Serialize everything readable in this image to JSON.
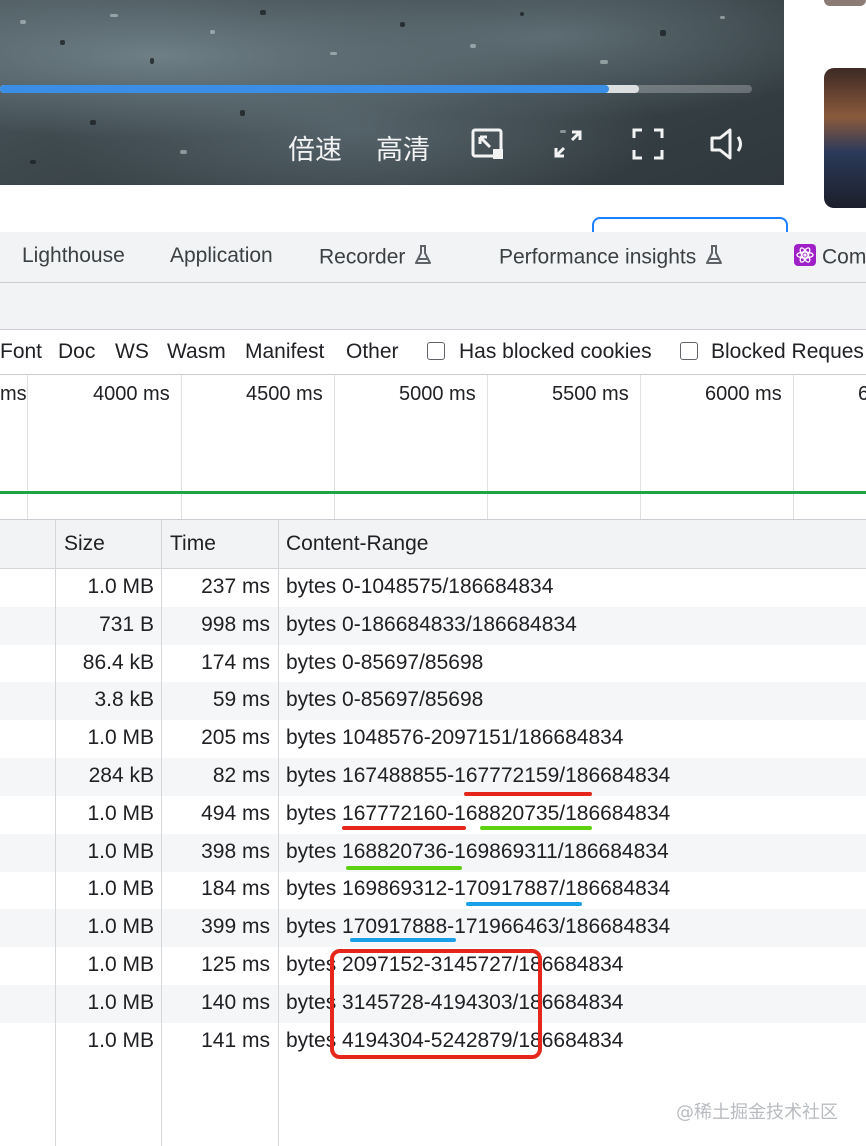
{
  "player": {
    "progress_played_fraction": 0.81,
    "progress_buffered_fraction": 0.85,
    "speed_label": "倍速",
    "quality_label": "高清",
    "accent_color": "#3a8ee6"
  },
  "devtools": {
    "tabs": [
      {
        "label": "Lighthouse"
      },
      {
        "label": "Application"
      },
      {
        "label": "Recorder"
      },
      {
        "label": "Performance insights"
      },
      {
        "label": "Com"
      }
    ],
    "filters": {
      "types": [
        "Font",
        "Doc",
        "WS",
        "Wasm",
        "Manifest",
        "Other"
      ],
      "checkboxes": [
        {
          "label": "Has blocked cookies",
          "checked": false
        },
        {
          "label": "Blocked Reques",
          "checked": false
        }
      ]
    },
    "timeline": {
      "ticks": [
        "ms",
        "4000 ms",
        "4500 ms",
        "5000 ms",
        "5500 ms",
        "6000 ms",
        "6"
      ]
    },
    "table": {
      "columns": [
        "Size",
        "Time",
        "Content-Range"
      ],
      "rows": [
        {
          "size": "1.0 MB",
          "time": "237 ms",
          "range": "bytes 0-1048575/186684834"
        },
        {
          "size": "731 B",
          "time": "998 ms",
          "range": "bytes 0-186684833/186684834"
        },
        {
          "size": "86.4 kB",
          "time": "174 ms",
          "range": "bytes 0-85697/85698"
        },
        {
          "size": "3.8 kB",
          "time": "59 ms",
          "range": "bytes 0-85697/85698"
        },
        {
          "size": "1.0 MB",
          "time": "205 ms",
          "range": "bytes 1048576-2097151/186684834"
        },
        {
          "size": "284 kB",
          "time": "82 ms",
          "range": "bytes 167488855-167772159/186684834"
        },
        {
          "size": "1.0 MB",
          "time": "494 ms",
          "range": "bytes 167772160-168820735/186684834"
        },
        {
          "size": "1.0 MB",
          "time": "398 ms",
          "range": "bytes 168820736-169869311/186684834"
        },
        {
          "size": "1.0 MB",
          "time": "184 ms",
          "range": "bytes 169869312-170917887/186684834"
        },
        {
          "size": "1.0 MB",
          "time": "399 ms",
          "range": "bytes 170917888-171966463/186684834"
        },
        {
          "size": "1.0 MB",
          "time": "125 ms",
          "range": "bytes 2097152-3145727/186684834"
        },
        {
          "size": "1.0 MB",
          "time": "140 ms",
          "range": "bytes 3145728-4194303/186684834"
        },
        {
          "size": "1.0 MB",
          "time": "141 ms",
          "range": "bytes 4194304-5242879/186684834"
        }
      ]
    }
  },
  "annotation_colors": {
    "red": "#e5271b",
    "green": "#5ed211",
    "blue": "#19a0e8"
  },
  "watermark": "@稀土掘金技术社区"
}
